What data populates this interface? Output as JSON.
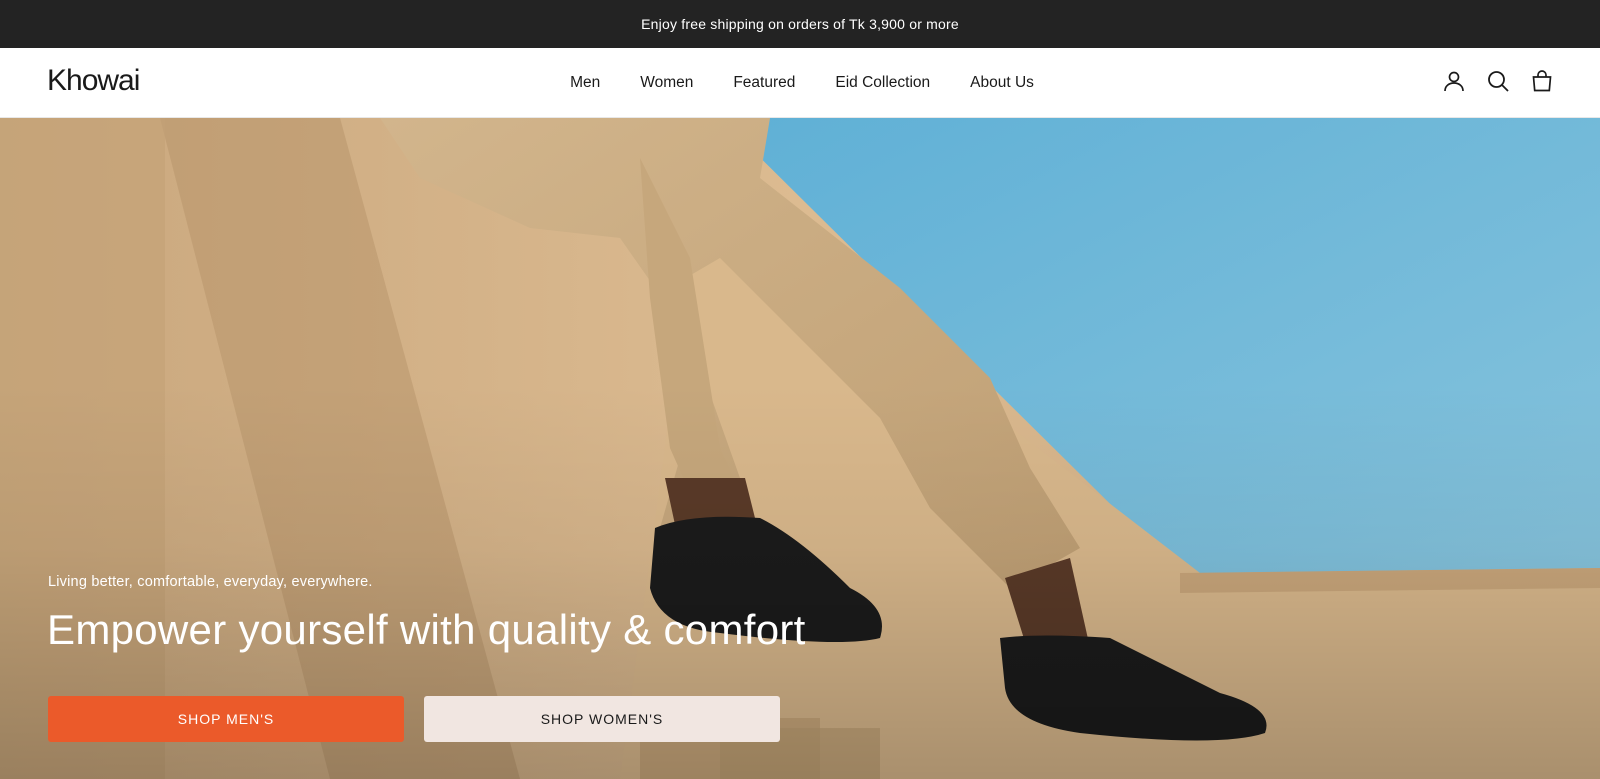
{
  "announcement": {
    "text": "Enjoy free shipping on orders of Tk 3,900 or more"
  },
  "header": {
    "logo": "Khowai",
    "nav": [
      {
        "label": "Men"
      },
      {
        "label": "Women"
      },
      {
        "label": "Featured"
      },
      {
        "label": "Eid Collection"
      },
      {
        "label": "About Us"
      }
    ],
    "icons": [
      "account-icon",
      "search-icon",
      "cart-bag-icon"
    ]
  },
  "hero": {
    "tagline": "Living better, comfortable, everyday, everywhere.",
    "headline": "Empower yourself with quality & comfort",
    "buttons": {
      "men": "SHOP MEN'S",
      "women": "SHOP WOMEN'S"
    }
  },
  "colors": {
    "announcement_bg": "#232323",
    "accent": "#eb5a2a",
    "secondary_button": "#f1e6e1",
    "sky": "#6cb7d6",
    "wall": "#d7b389"
  }
}
